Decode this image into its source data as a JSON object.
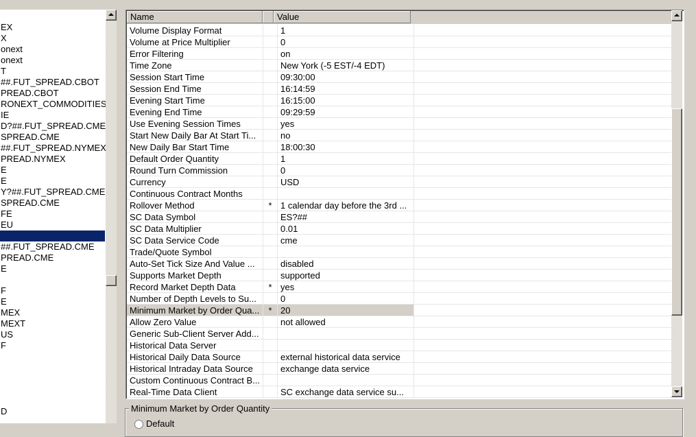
{
  "left_list": {
    "items": [
      {
        "label": "EX"
      },
      {
        "label": "X"
      },
      {
        "label": "onext"
      },
      {
        "label": "onext"
      },
      {
        "label": "T"
      },
      {
        "label": "##.FUT_SPREAD.CBOT"
      },
      {
        "label": "PREAD.CBOT"
      },
      {
        "label": "RONEXT_COMMODITIES"
      },
      {
        "label": "IE"
      },
      {
        "label": "D?##.FUT_SPREAD.CME"
      },
      {
        "label": "SPREAD.CME"
      },
      {
        "label": "##.FUT_SPREAD.NYMEX"
      },
      {
        "label": "PREAD.NYMEX"
      },
      {
        "label": "E"
      },
      {
        "label": "E"
      },
      {
        "label": "Y?##.FUT_SPREAD.CME"
      },
      {
        "label": "SPREAD.CME"
      },
      {
        "label": "FE"
      },
      {
        "label": "EU"
      },
      {
        "label": ""
      },
      {
        "label": "##.FUT_SPREAD.CME"
      },
      {
        "label": "PREAD.CME"
      },
      {
        "label": "E"
      },
      {
        "label": ""
      },
      {
        "label": "F"
      },
      {
        "label": "E"
      },
      {
        "label": "MEX"
      },
      {
        "label": "MEXT"
      },
      {
        "label": "US"
      },
      {
        "label": "F"
      },
      {
        "label": ""
      },
      {
        "label": ""
      },
      {
        "label": ""
      },
      {
        "label": ""
      },
      {
        "label": ""
      },
      {
        "label": "D"
      }
    ],
    "selected_index": 19
  },
  "grid": {
    "headers": {
      "name": "Name",
      "value": "Value"
    },
    "rows": [
      {
        "name": "Volume Display Format",
        "flag": "",
        "value": "1"
      },
      {
        "name": "Volume at Price Multiplier",
        "flag": "",
        "value": "0"
      },
      {
        "name": "Error Filtering",
        "flag": "",
        "value": "on"
      },
      {
        "name": "Time Zone",
        "flag": "",
        "value": "New York (-5 EST/-4 EDT)"
      },
      {
        "name": "Session Start Time",
        "flag": "",
        "value": "09:30:00"
      },
      {
        "name": "Session End Time",
        "flag": "",
        "value": "16:14:59"
      },
      {
        "name": "Evening Start Time",
        "flag": "",
        "value": "16:15:00"
      },
      {
        "name": "Evening End Time",
        "flag": "",
        "value": "09:29:59"
      },
      {
        "name": "Use Evening Session Times",
        "flag": "",
        "value": "yes"
      },
      {
        "name": "Start New Daily Bar At Start Ti...",
        "flag": "",
        "value": "no"
      },
      {
        "name": "New Daily Bar Start Time",
        "flag": "",
        "value": "18:00:30"
      },
      {
        "name": "Default Order Quantity",
        "flag": "",
        "value": "1"
      },
      {
        "name": "Round Turn Commission",
        "flag": "",
        "value": "0"
      },
      {
        "name": "Currency",
        "flag": "",
        "value": "USD"
      },
      {
        "name": "Continuous Contract Months",
        "flag": "",
        "value": ""
      },
      {
        "name": "Rollover Method",
        "flag": "*",
        "value": "1 calendar day before the 3rd ..."
      },
      {
        "name": "SC Data Symbol",
        "flag": "",
        "value": "ES?##"
      },
      {
        "name": "SC Data Multiplier",
        "flag": "",
        "value": "0.01"
      },
      {
        "name": "SC Data Service Code",
        "flag": "",
        "value": "cme"
      },
      {
        "name": "Trade/Quote Symbol",
        "flag": "",
        "value": ""
      },
      {
        "name": "Auto-Set Tick Size And Value ...",
        "flag": "",
        "value": "disabled"
      },
      {
        "name": "Supports Market Depth",
        "flag": "",
        "value": "supported"
      },
      {
        "name": "Record Market Depth Data",
        "flag": "*",
        "value": "yes"
      },
      {
        "name": "Number of Depth Levels to Su...",
        "flag": "",
        "value": "0"
      },
      {
        "name": "Minimum Market by Order Qua...",
        "flag": "*",
        "value": "20"
      },
      {
        "name": "Allow Zero Value",
        "flag": "",
        "value": "not allowed"
      },
      {
        "name": "Generic Sub-Client Server Add...",
        "flag": "",
        "value": ""
      },
      {
        "name": "Historical Data Server",
        "flag": "",
        "value": ""
      },
      {
        "name": "Historical Daily Data Source",
        "flag": "",
        "value": "external historical data service"
      },
      {
        "name": "Historical Intraday Data Source",
        "flag": "",
        "value": "exchange data service"
      },
      {
        "name": "Custom Continuous Contract B...",
        "flag": "",
        "value": ""
      },
      {
        "name": "Real-Time Data Client",
        "flag": "",
        "value": "SC exchange data service su..."
      }
    ],
    "highlighted_index": 24,
    "scroll_position": 0.55
  },
  "groupbox": {
    "title": "Minimum Market by Order Quantity",
    "radio_default_label": "Default"
  },
  "icons": {
    "scroll_up": "scroll-up-arrow-icon",
    "scroll_down": "scroll-down-arrow-icon"
  }
}
